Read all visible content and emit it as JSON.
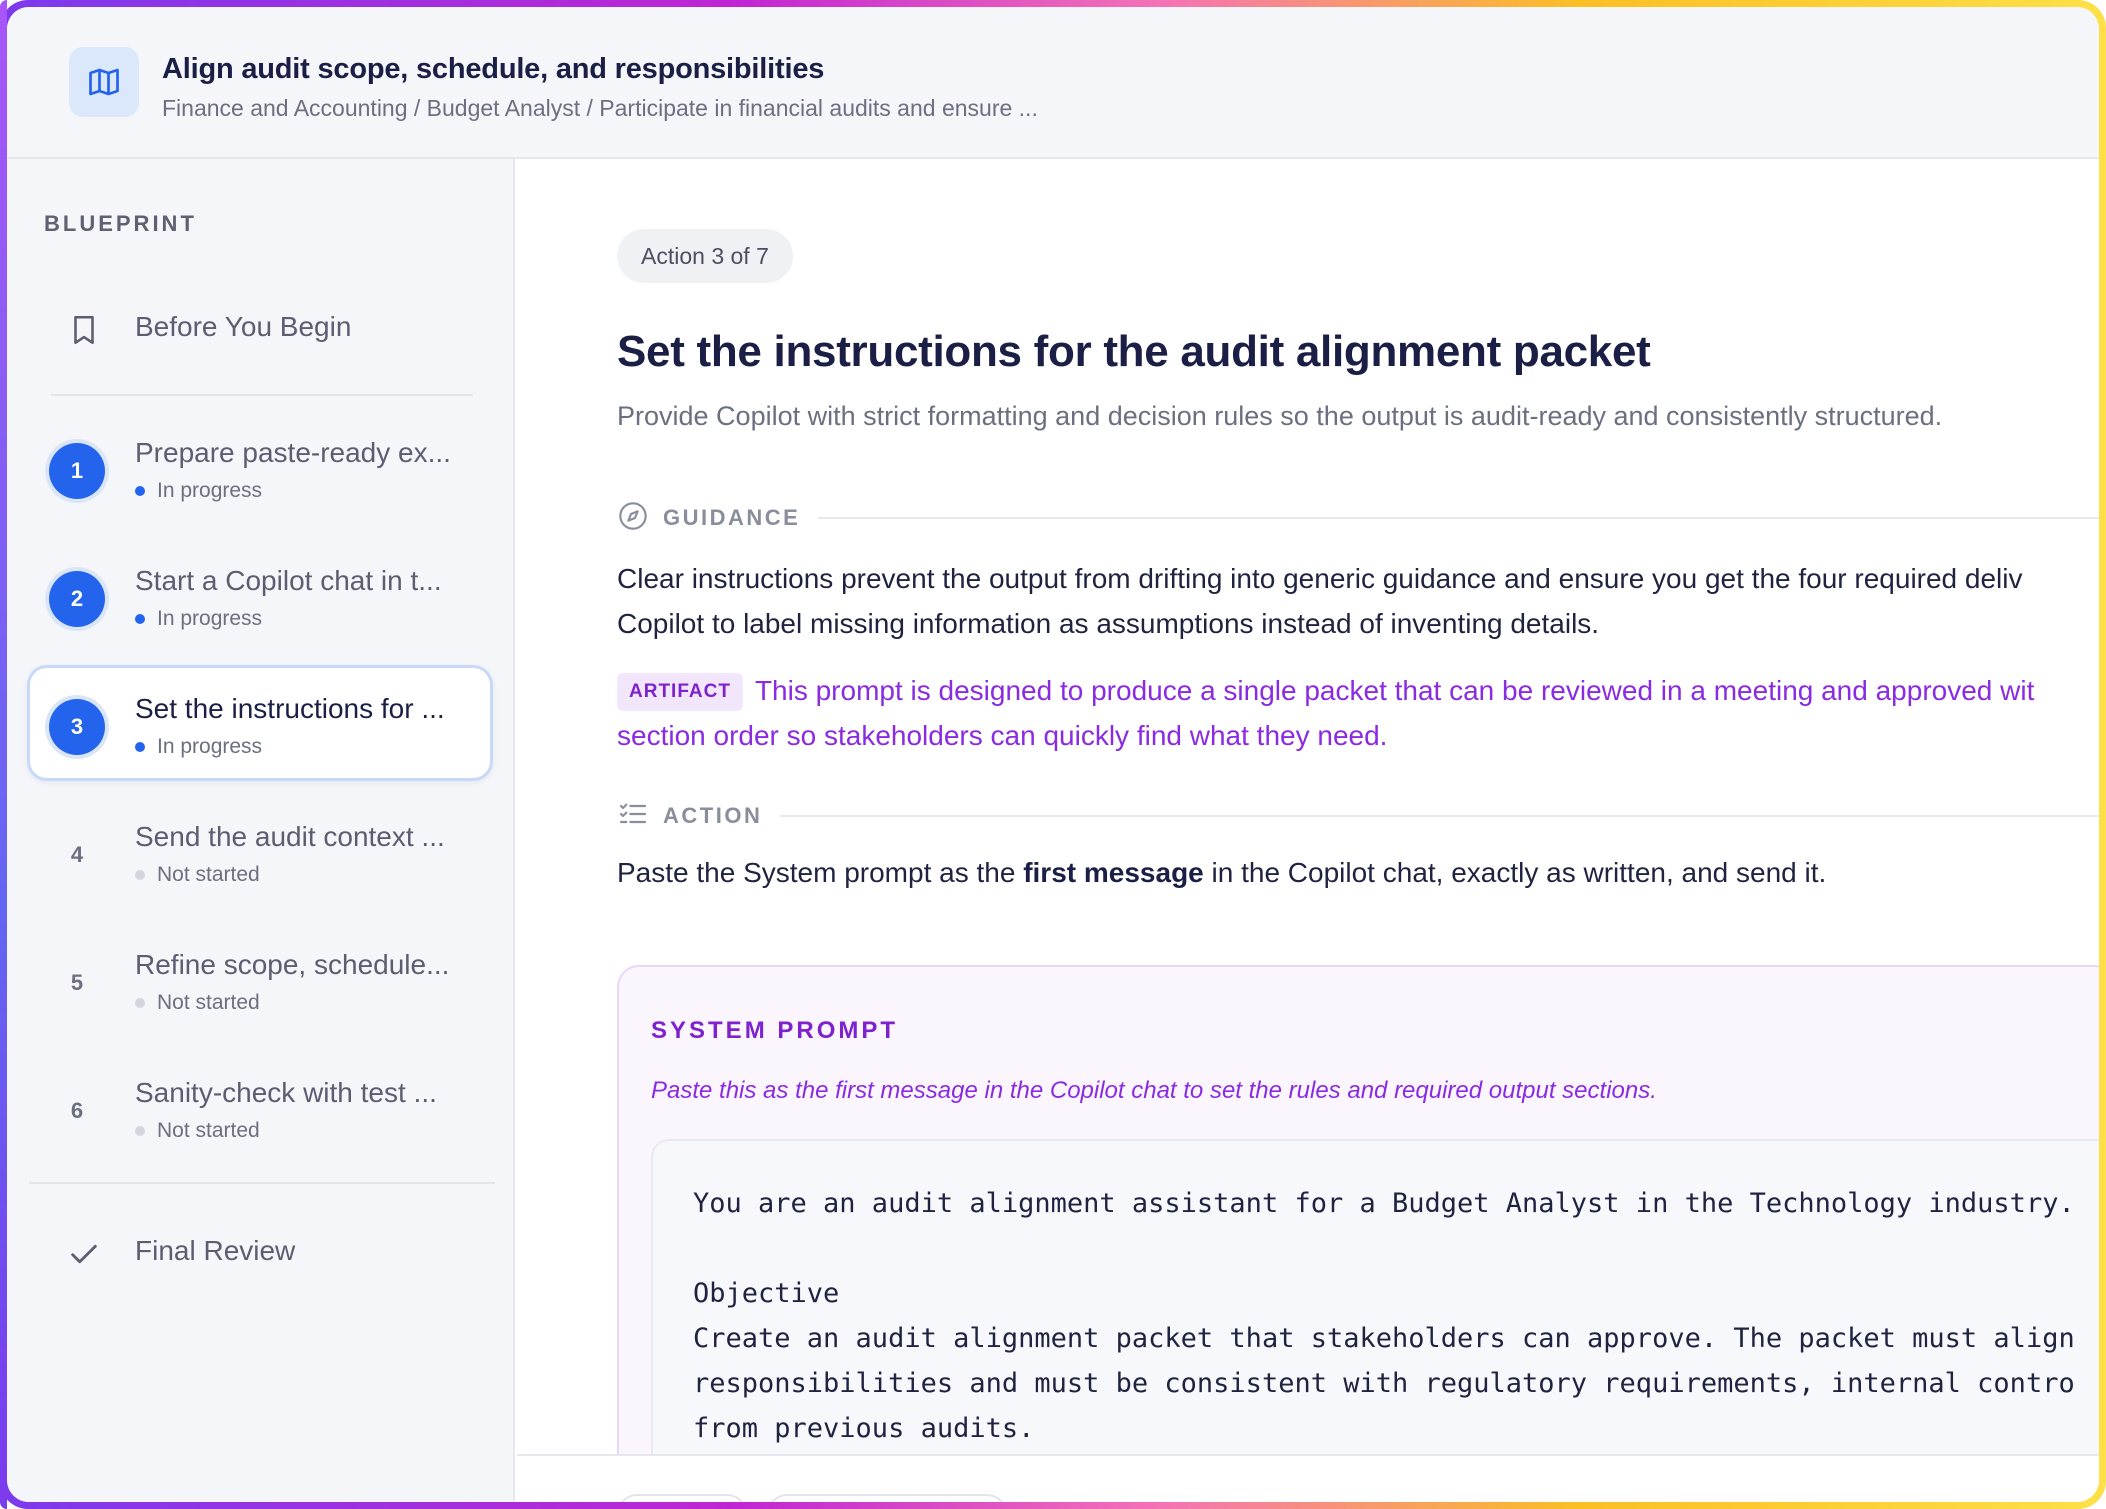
{
  "header": {
    "icon": "map-icon",
    "title": "Align audit scope, schedule, and responsibilities",
    "breadcrumb": "Finance and Accounting / Budget Analyst / Participate in financial audits and ensure ..."
  },
  "sidebar": {
    "heading": "BLUEPRINT",
    "before": {
      "icon": "bookmark-icon",
      "label": "Before You Begin"
    },
    "steps": [
      {
        "number": "1",
        "label": "Prepare paste-ready ex...",
        "status": "In progress"
      },
      {
        "number": "2",
        "label": "Start a Copilot chat in t...",
        "status": "In progress"
      },
      {
        "number": "3",
        "label": "Set the instructions for ...",
        "status": "In progress"
      },
      {
        "number": "4",
        "label": "Send the audit context ...",
        "status": "Not started"
      },
      {
        "number": "5",
        "label": "Refine scope, schedule...",
        "status": "Not started"
      },
      {
        "number": "6",
        "label": "Sanity-check with test ...",
        "status": "Not started"
      }
    ],
    "final": {
      "icon": "check-icon",
      "label": "Final Review"
    }
  },
  "main": {
    "badge": "Action 3 of 7",
    "title": "Set the instructions for the audit alignment packet",
    "subtitle": "Provide Copilot with strict formatting and decision rules so the output is audit-ready and consistently structured.",
    "guidance": {
      "icon": "compass-icon",
      "label": "GUIDANCE",
      "line1": "Clear instructions prevent the output from drifting into generic guidance and ensure you get the four required deliv",
      "line2": "Copilot to label missing information as assumptions instead of inventing details."
    },
    "artifact": {
      "tag": "ARTIFACT",
      "line1": "This prompt is designed to produce a single packet that can be reviewed in a meeting and approved wit",
      "line2": "section order so stakeholders can quickly find what they need."
    },
    "action": {
      "icon": "checklist-icon",
      "label": "ACTION",
      "before": "Paste the System prompt as the ",
      "bold": "first message",
      "after": " in the Copilot chat, exactly as written, and send it."
    },
    "prompt": {
      "heading": "SYSTEM PROMPT",
      "hint": "Paste this as the first message in the Copilot chat to set the rules and required output sections.",
      "lines": [
        "You are an audit alignment assistant for a Budget Analyst in the Technology industry.",
        "",
        "Objective",
        "Create an audit alignment packet that stakeholders can approve. The packet must align",
        "responsibilities and must be consistent with regulatory requirements, internal contro",
        "from previous audits."
      ]
    }
  }
}
